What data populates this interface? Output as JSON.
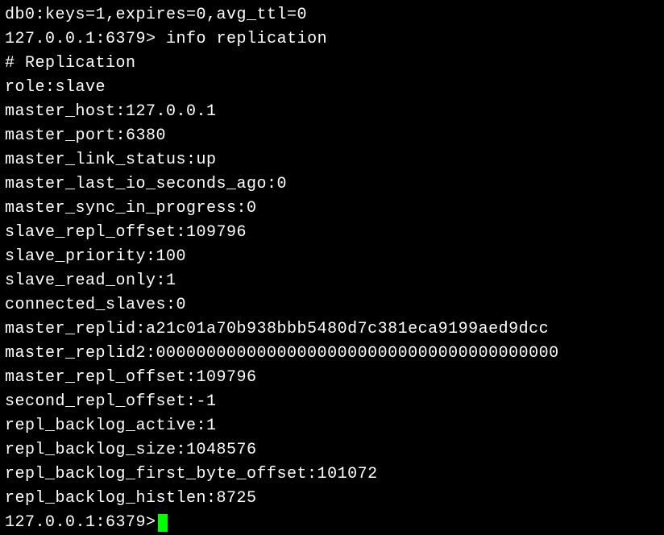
{
  "terminal": {
    "partial_top": "db0:keys=1,expires=0,avg_ttl=0",
    "prompt_host": "127.0.0.1:6379>",
    "command": "info replication",
    "header": "# Replication",
    "lines": [
      "role:slave",
      "master_host:127.0.0.1",
      "master_port:6380",
      "master_link_status:up",
      "master_last_io_seconds_ago:0",
      "master_sync_in_progress:0",
      "slave_repl_offset:109796",
      "slave_priority:100",
      "slave_read_only:1",
      "connected_slaves:0",
      "master_replid:a21c01a70b938bbb5480d7c381eca9199aed9dcc",
      "master_replid2:0000000000000000000000000000000000000000",
      "master_repl_offset:109796",
      "second_repl_offset:-1",
      "repl_backlog_active:1",
      "repl_backlog_size:1048576",
      "repl_backlog_first_byte_offset:101072",
      "repl_backlog_histlen:8725"
    ],
    "prompt2": "127.0.0.1:6379> "
  }
}
